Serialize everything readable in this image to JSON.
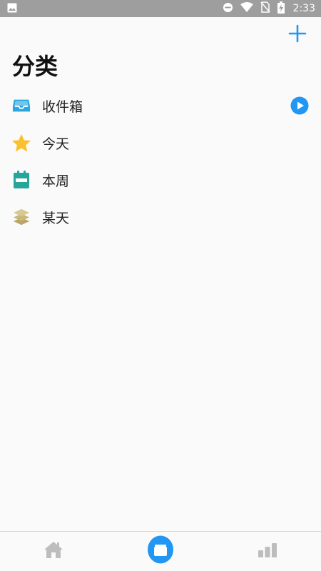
{
  "status_bar": {
    "time": "2:33",
    "icons": [
      "image-icon",
      "do-not-disturb-icon",
      "wifi-icon",
      "no-sim-icon",
      "battery-charging-icon"
    ]
  },
  "header": {
    "add_icon": "plus-icon",
    "title": "分类"
  },
  "categories": [
    {
      "label": "收件箱",
      "icon": "inbox-icon",
      "color": "#29a8e0"
    },
    {
      "label": "今天",
      "icon": "star-icon",
      "color": "#fbc02d"
    },
    {
      "label": "本周",
      "icon": "calendar-icon",
      "color": "#26a69a"
    },
    {
      "label": "某天",
      "icon": "layers-icon",
      "color": "#c9b77a"
    }
  ],
  "inbox_action_icon": "play-icon",
  "bottom_nav": [
    {
      "name": "home",
      "icon": "home-icon"
    },
    {
      "name": "categories",
      "icon": "categories-icon",
      "active": true
    },
    {
      "name": "stats",
      "icon": "bar-chart-icon"
    }
  ],
  "colors": {
    "accent": "#2196f3",
    "status_bar": "#9e9e9e",
    "background": "#fafafa",
    "nav_inactive": "#bdbdbd"
  }
}
